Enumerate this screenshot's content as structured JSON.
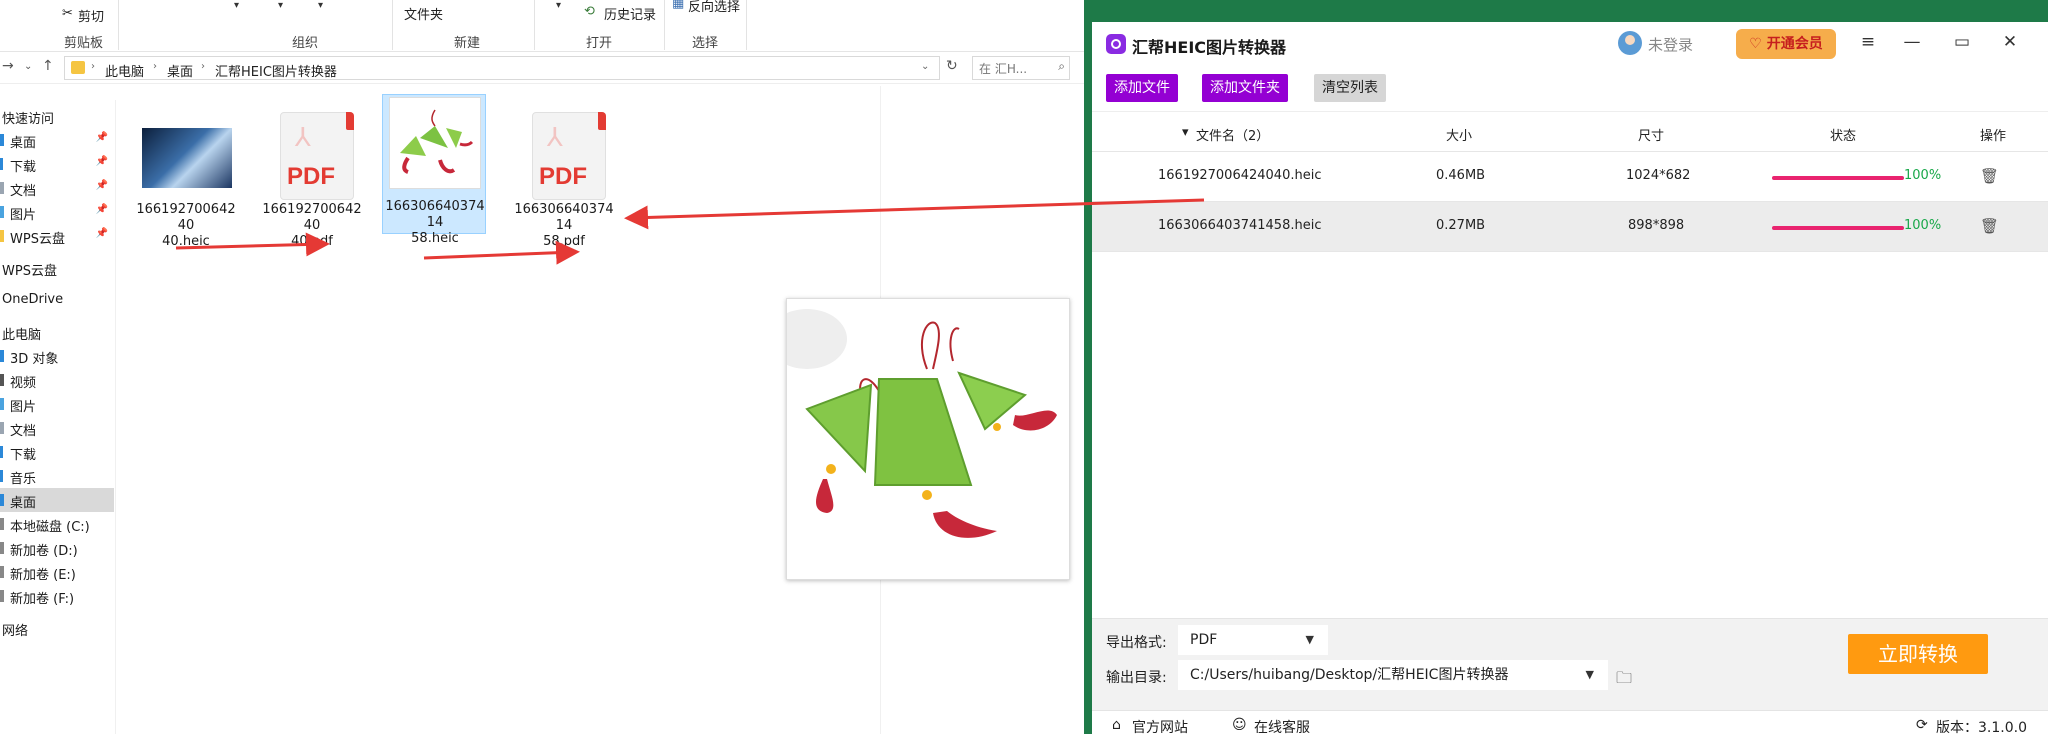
{
  "explorer": {
    "ribbon": {
      "cut_label": "剪切",
      "folder_label": "文件夹",
      "history_label": "历史记录",
      "invert_label": "反向选择",
      "groups": {
        "clipboard": "剪贴板",
        "organize": "组织",
        "new": "新建",
        "open": "打开",
        "select": "选择"
      }
    },
    "breadcrumb": [
      "此电脑",
      "桌面",
      "汇帮HEIC图片转换器"
    ],
    "search_placeholder": "在 汇H...",
    "nav": {
      "quick_access": "快速访问",
      "quick_items": [
        "桌面",
        "下载",
        "文档",
        "图片",
        "WPS云盘"
      ],
      "wps": "WPS云盘",
      "onedrive": "OneDrive",
      "this_pc": "此电脑",
      "pc_items": [
        "3D 对象",
        "视频",
        "图片",
        "文档",
        "下载",
        "音乐",
        "桌面",
        "本地磁盘 (C:)",
        "新加卷 (D:)",
        "新加卷 (E:)",
        "新加卷 (F:)"
      ],
      "network": "网络"
    },
    "files": [
      {
        "name_line1": "16619270064240",
        "name_line2": "40.heic",
        "kind": "photo"
      },
      {
        "name_line1": "16619270064240",
        "name_line2": "40.pdf",
        "kind": "pdf"
      },
      {
        "name_line1": "16630664037414",
        "name_line2": "58.heic",
        "kind": "zongzi"
      },
      {
        "name_line1": "16630664037414",
        "name_line2": "58.pdf",
        "kind": "pdf"
      }
    ],
    "pdf_text": "PDF"
  },
  "app": {
    "title": "汇帮HEIC图片转换器",
    "login": "未登录",
    "vip": "开通会员",
    "toolbar": {
      "add_file": "添加文件",
      "add_folder": "添加文件夹",
      "clear_list": "清空列表"
    },
    "table": {
      "headers": {
        "name": "文件名（2）",
        "size": "大小",
        "dims": "尺寸",
        "status": "状态",
        "action": "操作"
      },
      "rows": [
        {
          "name": "1661927006424040.heic",
          "size": "0.46MB",
          "dims": "1024*682",
          "progress": 1.0,
          "pct": "100%"
        },
        {
          "name": "1663066403741458.heic",
          "size": "0.27MB",
          "dims": "898*898",
          "progress": 1.0,
          "pct": "100%"
        }
      ]
    },
    "export_label": "导出格式:",
    "export_value": "PDF",
    "output_label": "输出目录:",
    "output_value": "C:/Users/huibang/Desktop/汇帮HEIC图片转换器",
    "convert": "立即转换",
    "footer": {
      "site": "官方网站",
      "service": "在线客服",
      "version": "版本：3.1.0.0"
    },
    "colors": {
      "purple": "#9400d3",
      "orange": "#ff9a10",
      "progress": "#e9246f",
      "frame": "#1e7a48"
    }
  }
}
